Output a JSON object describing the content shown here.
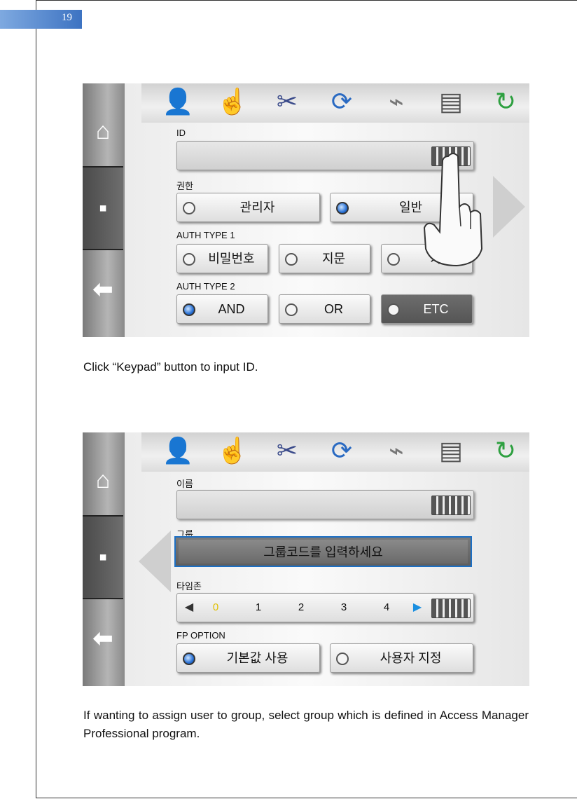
{
  "page": {
    "number": "19"
  },
  "screen1": {
    "toolbar_icons": [
      "user-icon",
      "fingerprint-icon",
      "tools-icon",
      "network-icon",
      "usb-icon",
      "printer-icon",
      "refresh-icon"
    ],
    "sidebar_icons": [
      "home-icon",
      "save-icon",
      "back-icon"
    ],
    "id_label": "ID",
    "permission_label": "권한",
    "permission_options": [
      {
        "label": "관리자",
        "selected": false
      },
      {
        "label": "일반",
        "selected": true
      }
    ],
    "auth_type1_label": "AUTH TYPE 1",
    "auth_type1_options": [
      {
        "label": "비밀번호",
        "selected": false
      },
      {
        "label": "지문",
        "selected": false
      },
      {
        "label": "카",
        "selected": false
      }
    ],
    "auth_type2_label": "AUTH TYPE 2",
    "auth_type2_options": [
      {
        "label": "AND",
        "selected": true
      },
      {
        "label": "OR",
        "selected": false
      },
      {
        "label": "ETC",
        "selected": false
      }
    ]
  },
  "caption1": "Click “Keypad” button to input ID.",
  "screen2": {
    "name_label": "이름",
    "group_label": "그룹",
    "group_placeholder": "그룹코드를 입력하세요",
    "timezone_label": "타임존",
    "timezone_values": [
      "0",
      "1",
      "2",
      "3",
      "4"
    ],
    "fp_option_label": "FP OPTION",
    "fp_options": [
      {
        "label": "기본값 사용",
        "selected": true
      },
      {
        "label": "사용자 지정",
        "selected": false
      }
    ]
  },
  "caption2": "If wanting to assign user to group, select group which is defined in Access Manager Professional program."
}
